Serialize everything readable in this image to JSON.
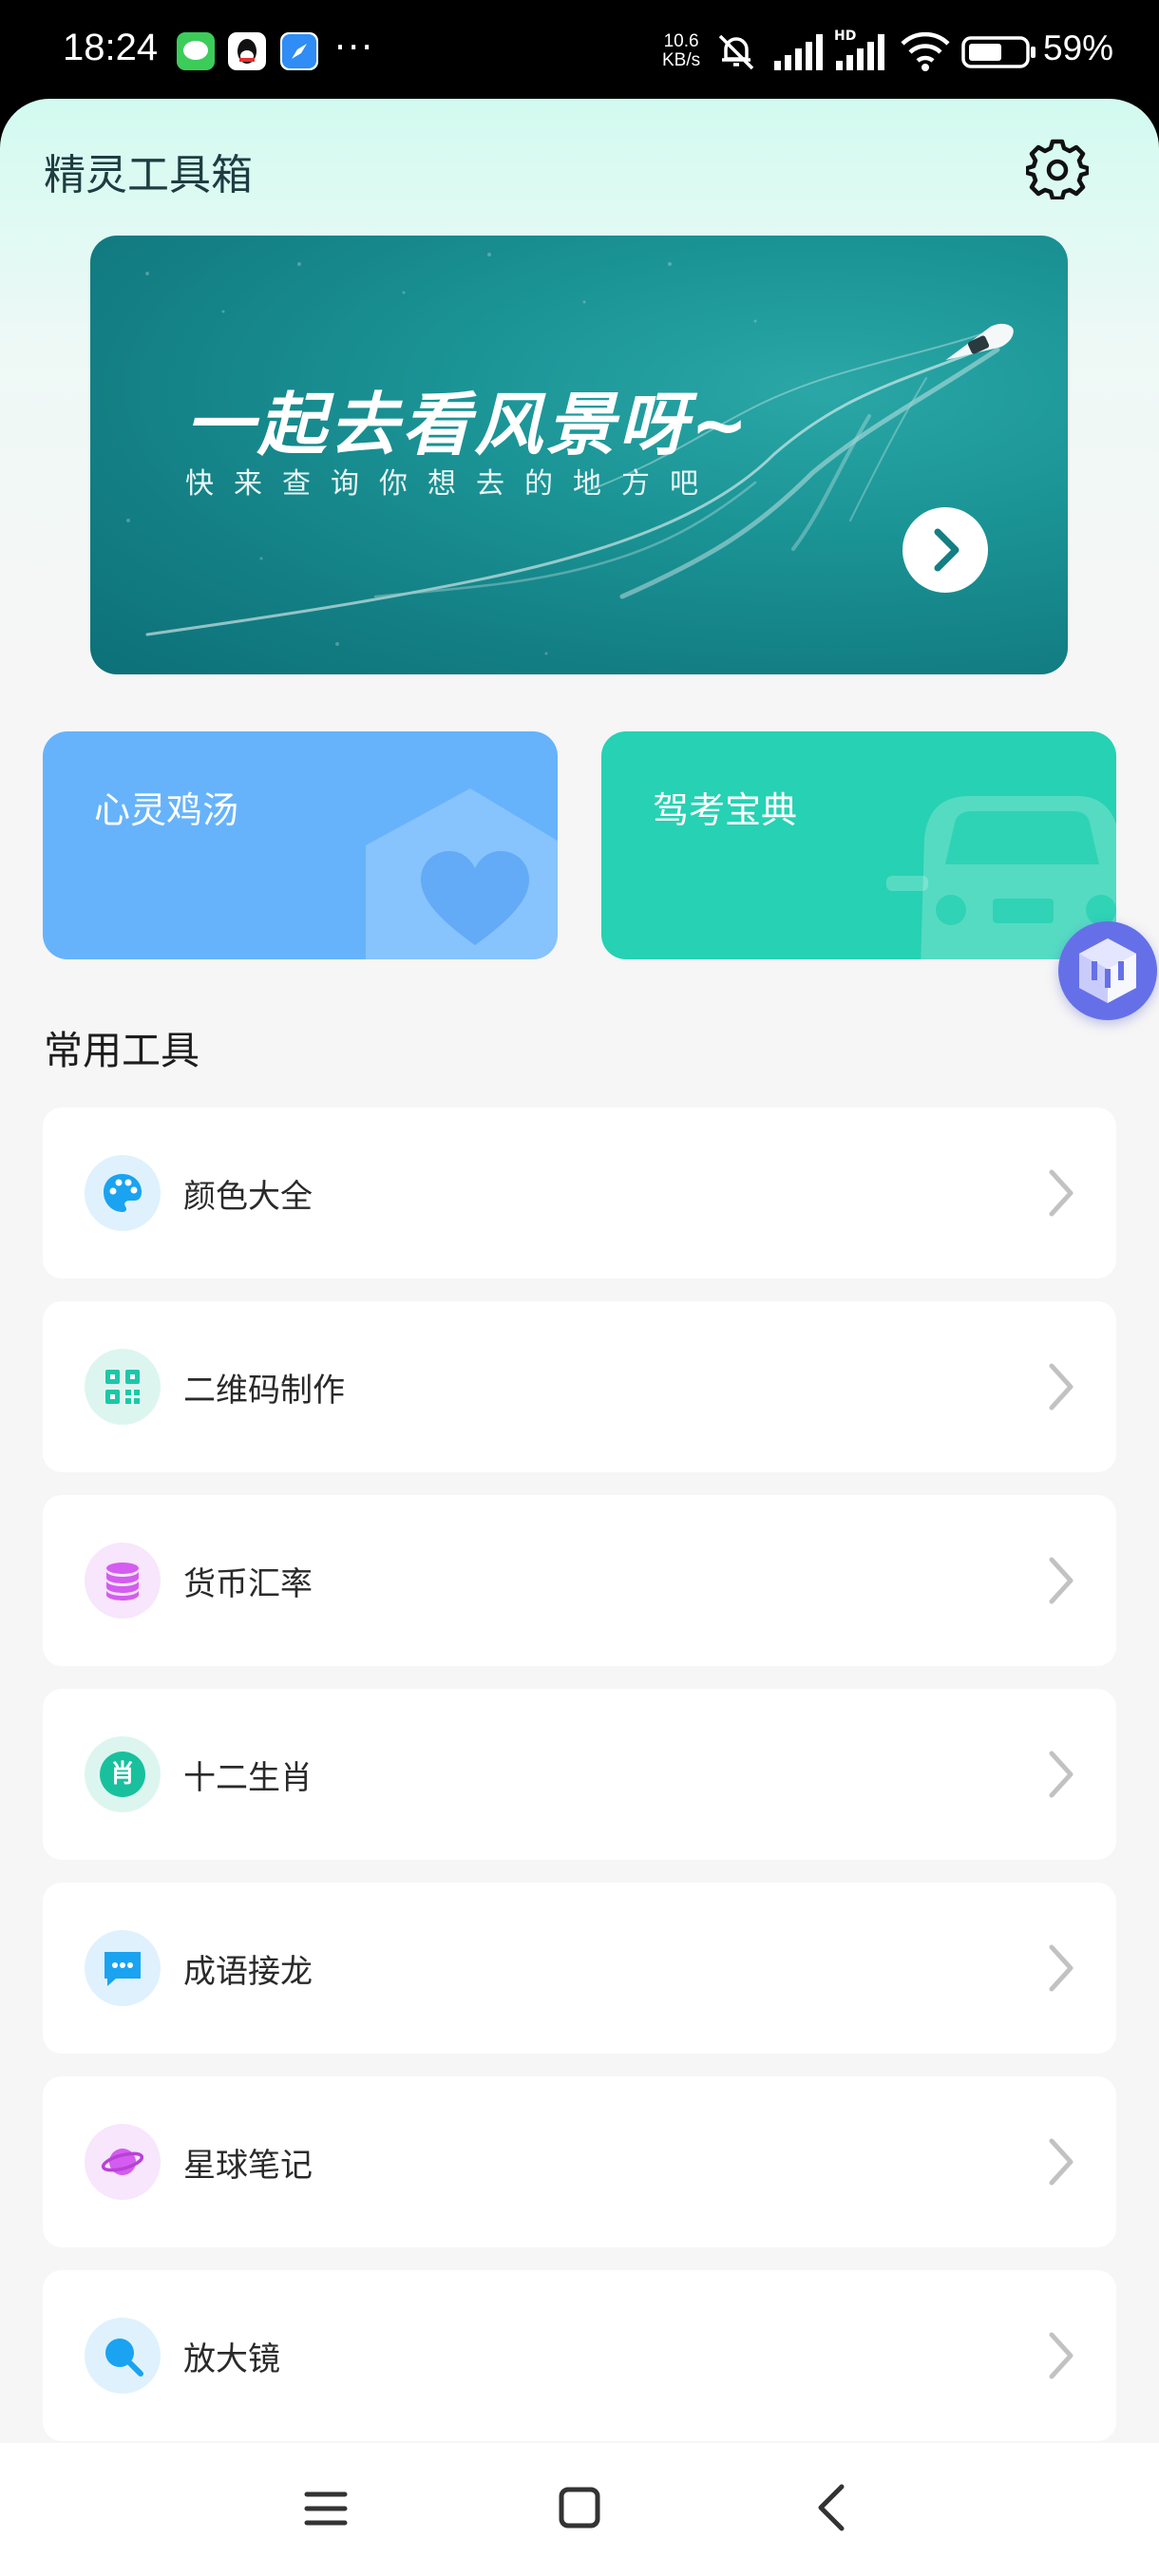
{
  "status_bar": {
    "time": "18:24",
    "network_speed_value": "10.6",
    "network_speed_unit": "KB/s",
    "signal_label": "HD",
    "battery": "59%",
    "notification_overflow": "···"
  },
  "header": {
    "title": "精灵工具箱"
  },
  "banner": {
    "title": "一起去看风景呀~",
    "subtitle": "快来查询你想去的地方吧"
  },
  "feature_cards": [
    {
      "label": "心灵鸡汤",
      "color": "#66b3fc"
    },
    {
      "label": "驾考宝典",
      "color": "#27d1b3"
    }
  ],
  "section": {
    "title": "常用工具"
  },
  "tools": [
    {
      "label": "颜色大全",
      "icon": "palette-icon",
      "color": "#1aa3f0"
    },
    {
      "label": "二维码制作",
      "icon": "qr-code-icon",
      "color": "#1dc7a8"
    },
    {
      "label": "货币汇率",
      "icon": "coins-icon",
      "color": "#d45cf0"
    },
    {
      "label": "十二生肖",
      "icon": "zodiac-icon",
      "color": "#19c09e",
      "glyph": "肖"
    },
    {
      "label": "成语接龙",
      "icon": "chat-icon",
      "color": "#1aa3f0"
    },
    {
      "label": "星球笔记",
      "icon": "planet-icon",
      "color": "#d45cf0"
    },
    {
      "label": "放大镜",
      "icon": "magnifier-icon",
      "color": "#1aa3f0"
    }
  ]
}
